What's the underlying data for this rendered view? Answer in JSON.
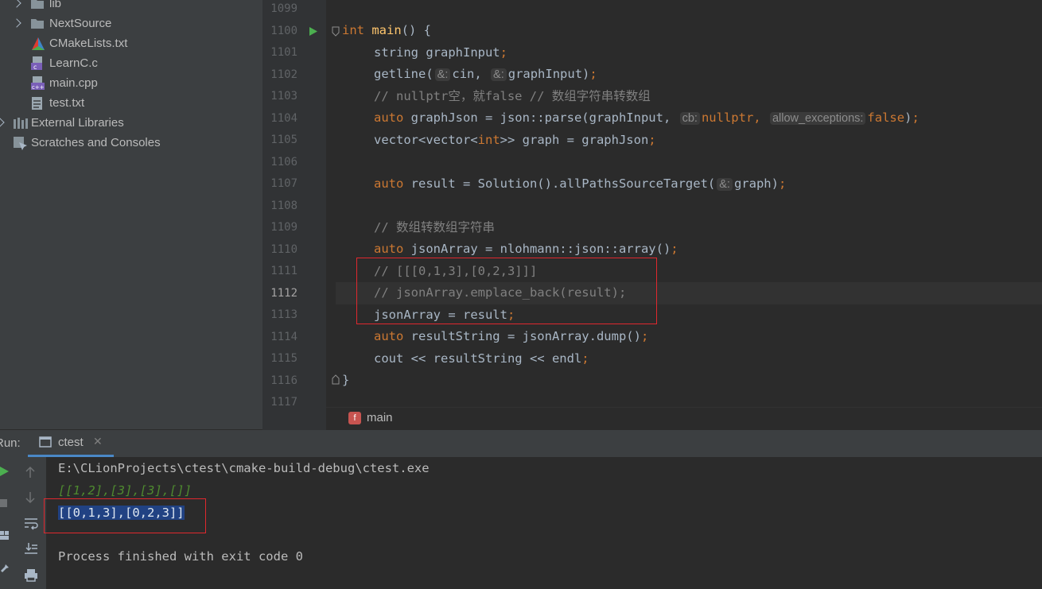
{
  "project_tree": {
    "items": [
      {
        "label": "lib",
        "icon": "folder-icon",
        "expandable": true
      },
      {
        "label": "NextSource",
        "icon": "folder-icon",
        "expandable": true
      },
      {
        "label": "CMakeLists.txt",
        "icon": "cmake-icon"
      },
      {
        "label": "LearnC.c",
        "icon": "c-file-icon"
      },
      {
        "label": "main.cpp",
        "icon": "cpp-file-icon"
      },
      {
        "label": "test.txt",
        "icon": "text-file-icon"
      },
      {
        "label": "External Libraries",
        "icon": "libraries-icon",
        "expandable": true
      },
      {
        "label": "Scratches and Consoles",
        "icon": "scratches-icon"
      }
    ]
  },
  "editor": {
    "line_numbers": [
      "1099",
      "1100",
      "1101",
      "1102",
      "1103",
      "1104",
      "1105",
      "1106",
      "1107",
      "1108",
      "1109",
      "1110",
      "1111",
      "1112",
      "1113",
      "1114",
      "1115",
      "1116",
      "1117"
    ],
    "active_line": "1112",
    "hints": {
      "ref": "&:",
      "cb": "cb:",
      "allow_exceptions": "allow_exceptions:"
    },
    "code": {
      "l1100": {
        "kw": "int",
        "fn": "main",
        "rest": "() {"
      },
      "l1101": {
        "text": "string graphInput",
        "semi": ";"
      },
      "l1102": {
        "a": "getline(",
        "b": "cin, ",
        "c": "graphInput)",
        "semi": ";"
      },
      "l1103": {
        "comment": "// nullptr空，就false // 数组字符串转数组"
      },
      "l1104": {
        "kw": "auto",
        "a": " graphJson = json::parse(graphInput, ",
        "b": "nullptr",
        "c": ", ",
        "d": "false",
        "e": ")",
        "semi": ";"
      },
      "l1105": {
        "a": "vector<vector<",
        "kw": "int",
        "b": ">> graph = graphJson",
        "semi": ";"
      },
      "l1107": {
        "kw": "auto",
        "a": " result = Solution().allPathsSourceTarget(",
        "b": "graph)",
        "semi": ";"
      },
      "l1109": {
        "comment": "// 数组转数组字符串"
      },
      "l1110": {
        "kw": "auto",
        "a": " jsonArray = nlohmann::json::array()",
        "semi": ";"
      },
      "l1111": {
        "comment": "// [[[0,1,3],[0,2,3]]]"
      },
      "l1112": {
        "comment": "// jsonArray.emplace_back(result);"
      },
      "l1113": {
        "a": "jsonArray = result",
        "semi": ";"
      },
      "l1114": {
        "kw": "auto",
        "a": " resultString = jsonArray.dump()",
        "semi": ";"
      },
      "l1115": {
        "a": "cout << resultString << endl",
        "semi": ";"
      },
      "l1116": {
        "text": "}"
      }
    },
    "breadcrumb": {
      "badge": "f",
      "label": "main"
    }
  },
  "run_panel": {
    "label": "Run:",
    "tab": "ctest",
    "output": [
      {
        "text": "E:\\CLionProjects\\ctest\\cmake-build-debug\\ctest.exe",
        "style": "normal"
      },
      {
        "text": "[[1,2],[3],[3],[]]",
        "style": "italic-green"
      },
      {
        "text": "[[0,1,3],[0,2,3]]",
        "style": "selected"
      },
      {
        "text": "",
        "style": "normal"
      },
      {
        "text": "Process finished with exit code 0",
        "style": "normal"
      }
    ]
  },
  "colors": {
    "keyword": "#cc7832",
    "function": "#ffc66d",
    "comment": "#808080",
    "text": "#a9b7c6",
    "annotation": "#e0282e",
    "selection": "#214283"
  }
}
